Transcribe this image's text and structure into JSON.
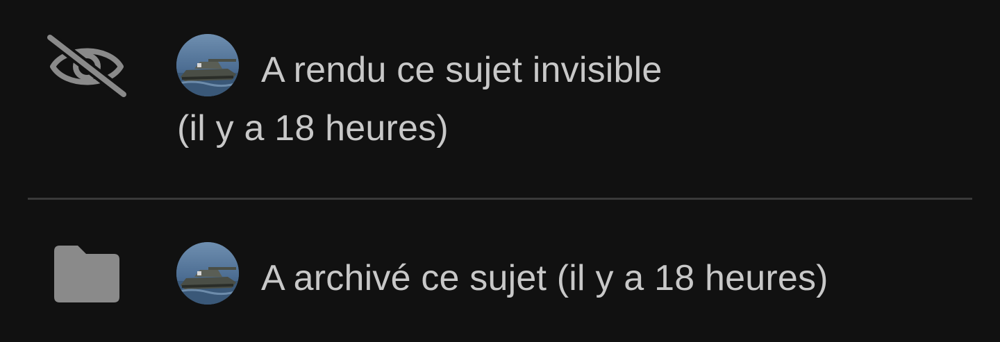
{
  "theme": {
    "background": "#111111",
    "text_color": "#c8c8c8",
    "icon_color": "#8a8a8a",
    "divider_color": "#3a3a3a"
  },
  "events": [
    {
      "icon": "eye-slash-icon",
      "action_text": "A rendu ce sujet invisible",
      "time_text": "(il y a 18 heures)"
    },
    {
      "icon": "folder-icon",
      "action_text": "A archivé ce sujet (il y a 18 heures)"
    }
  ]
}
